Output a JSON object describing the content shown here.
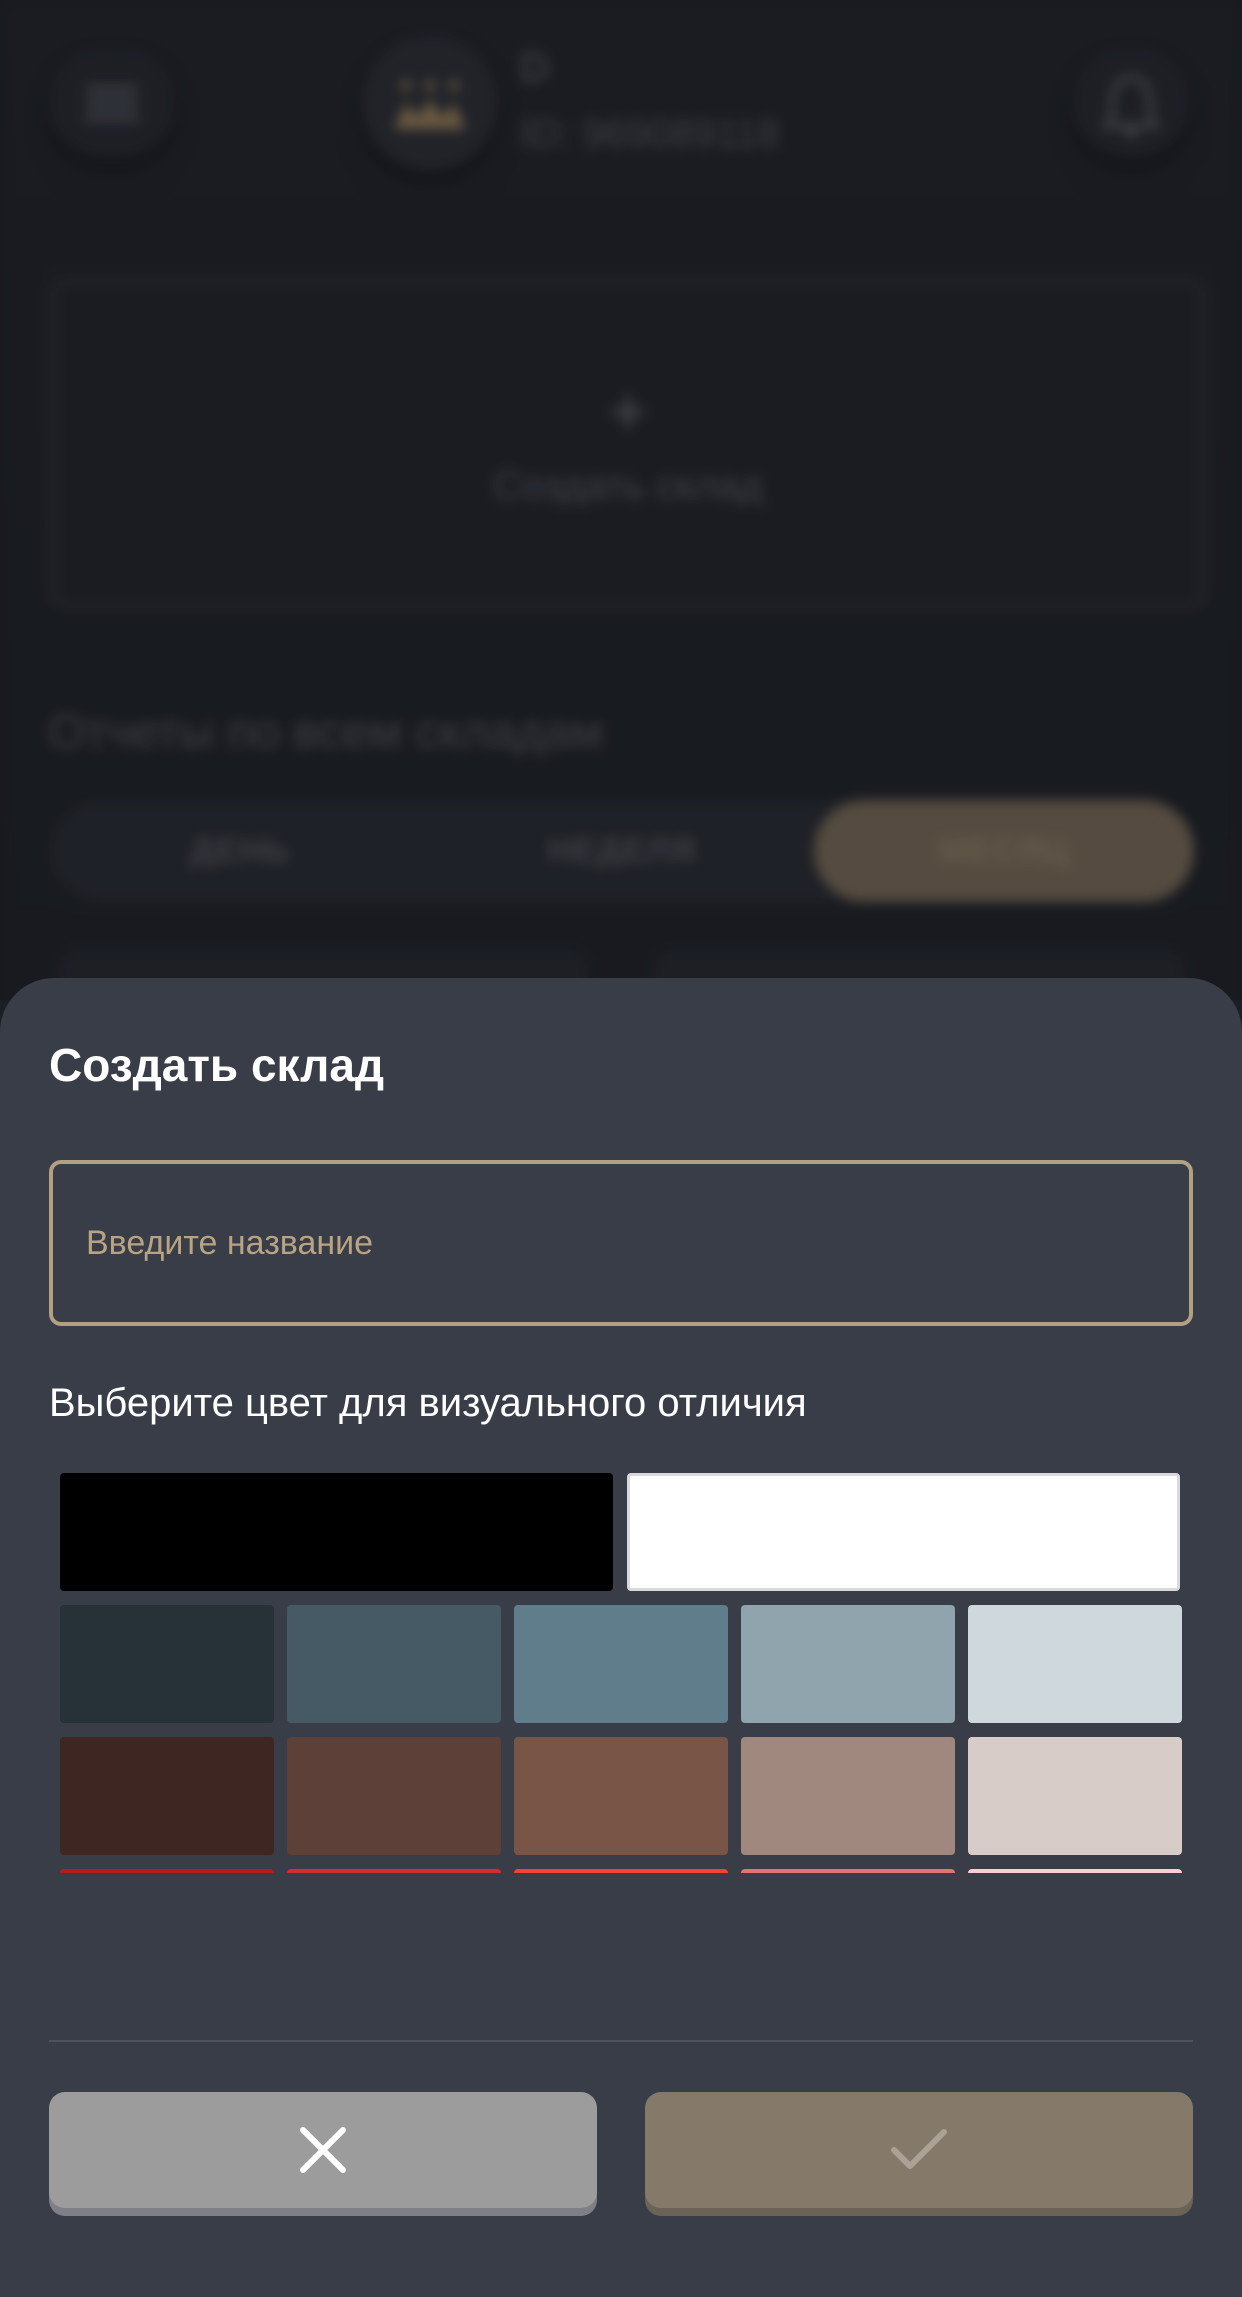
{
  "header": {
    "user_name": "D",
    "user_id": "ID: 969089118"
  },
  "create_card": {
    "plus": "+",
    "label": "Создать склад"
  },
  "reports": {
    "title": "Отчеты по всем складам",
    "tabs": [
      {
        "label": "ДЕНЬ",
        "active": false
      },
      {
        "label": "НЕДЕЛЯ",
        "active": false
      },
      {
        "label": "МЕСЯЦ",
        "active": true
      }
    ]
  },
  "sheet": {
    "title": "Создать склад",
    "name_input": {
      "value": "",
      "placeholder": "Введите название"
    },
    "color_label": "Выберите цвет для визуального отличия",
    "palette": {
      "top_row": [
        "#000000",
        "#ffffff"
      ],
      "rows": [
        [
          "#263238",
          "#455a64",
          "#607d8b",
          "#90a4ae",
          "#cfd8dc"
        ],
        [
          "#3e2723",
          "#5d4037",
          "#795548",
          "#a1887f",
          "#d7ccc8"
        ],
        [
          "#b71c1c",
          "#d32f2f",
          "#f44336",
          "#e57373",
          "#ffcdd2"
        ]
      ]
    },
    "cancel_icon": "close-icon",
    "confirm_icon": "check-icon"
  },
  "colors": {
    "accent": "#b39f81",
    "sheet_bg": "#393d47",
    "cancel_bg": "#9c9c9c",
    "confirm_bg": "#857a6a"
  }
}
